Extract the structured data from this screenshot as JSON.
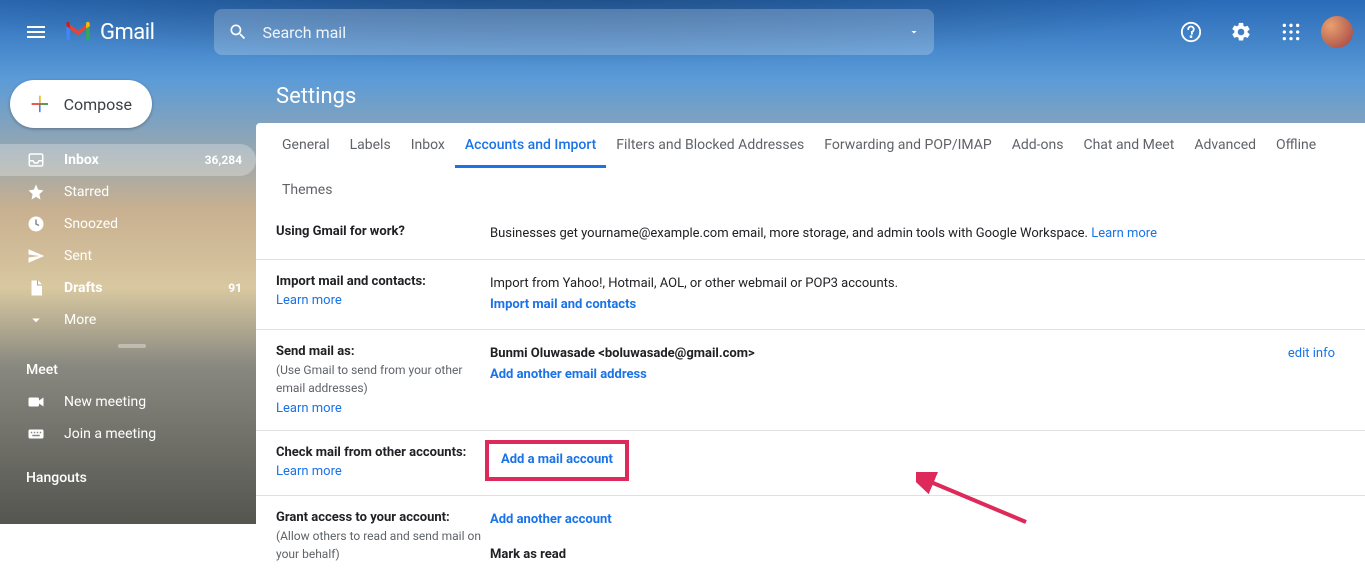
{
  "header": {
    "logo_text": "Gmail",
    "search_placeholder": "Search mail"
  },
  "sidebar": {
    "compose_label": "Compose",
    "items": [
      {
        "label": "Inbox",
        "count": "36,284",
        "icon": "inbox"
      },
      {
        "label": "Starred",
        "count": "",
        "icon": "star"
      },
      {
        "label": "Snoozed",
        "count": "",
        "icon": "clock"
      },
      {
        "label": "Sent",
        "count": "",
        "icon": "send"
      },
      {
        "label": "Drafts",
        "count": "91",
        "icon": "file"
      },
      {
        "label": "More",
        "count": "",
        "icon": "chevron-down"
      }
    ],
    "meet_title": "Meet",
    "meet_items": [
      {
        "label": "New meeting",
        "icon": "video"
      },
      {
        "label": "Join a meeting",
        "icon": "keyboard"
      }
    ],
    "hangouts_title": "Hangouts"
  },
  "settings": {
    "title": "Settings",
    "tabs": [
      "General",
      "Labels",
      "Inbox",
      "Accounts and Import",
      "Filters and Blocked Addresses",
      "Forwarding and POP/IMAP",
      "Add-ons",
      "Chat and Meet",
      "Advanced",
      "Offline",
      "Themes"
    ],
    "active_tab": "Accounts and Import",
    "sections": {
      "work": {
        "title": "Using Gmail for work?",
        "body": "Businesses get yourname@example.com email, more storage, and admin tools with Google Workspace. ",
        "learn_link": "Learn more"
      },
      "import": {
        "title": "Import mail and contacts:",
        "learn": "Learn more",
        "body": "Import from Yahoo!, Hotmail, AOL, or other webmail or POP3 accounts.",
        "action": "Import mail and contacts"
      },
      "sendas": {
        "title": "Send mail as:",
        "sub": "(Use Gmail to send from your other email addresses)",
        "learn": "Learn more",
        "identity": "Bunmi Oluwasade <boluwasade@gmail.com>",
        "action": "Add another email address",
        "edit": "edit info"
      },
      "checkmail": {
        "title": "Check mail from other accounts:",
        "learn": "Learn more",
        "action": "Add a mail account"
      },
      "grant": {
        "title": "Grant access to your account:",
        "sub": "(Allow others to read and send mail on your behalf)",
        "action": "Add another account",
        "mark": "Mark as read"
      }
    }
  }
}
